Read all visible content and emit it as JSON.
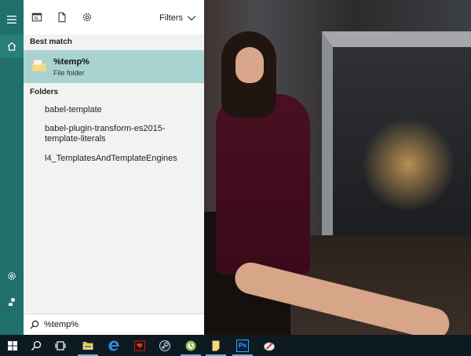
{
  "panel": {
    "filters_label": "Filters",
    "best_match_heading": "Best match",
    "best_match": {
      "title": "%temp%",
      "subtitle": "File folder"
    },
    "folders_heading": "Folders",
    "folders": [
      "babel-template",
      "babel-plugin-transform-es2015-template-literals",
      "l4_TemplatesAndTemplateEngines"
    ]
  },
  "search": {
    "value": "%temp%"
  },
  "rail": {
    "icons": [
      "hamburger-menu-icon",
      "home-icon",
      "settings-icon",
      "feedback-icon"
    ]
  },
  "taskbar": {
    "icons": [
      "windows-start-icon",
      "search-icon",
      "task-view-icon",
      "file-explorer-icon",
      "edge-icon",
      "app-red-icon",
      "steam-icon",
      "app-green-icon",
      "sticky-notes-icon",
      "photoshop-icon",
      "app-pen-icon"
    ],
    "photoshop_label": "Ps"
  },
  "colors": {
    "rail": "#1f6f6b",
    "selected_row": "#a9d3d1",
    "taskbar": "#0e1a22"
  }
}
